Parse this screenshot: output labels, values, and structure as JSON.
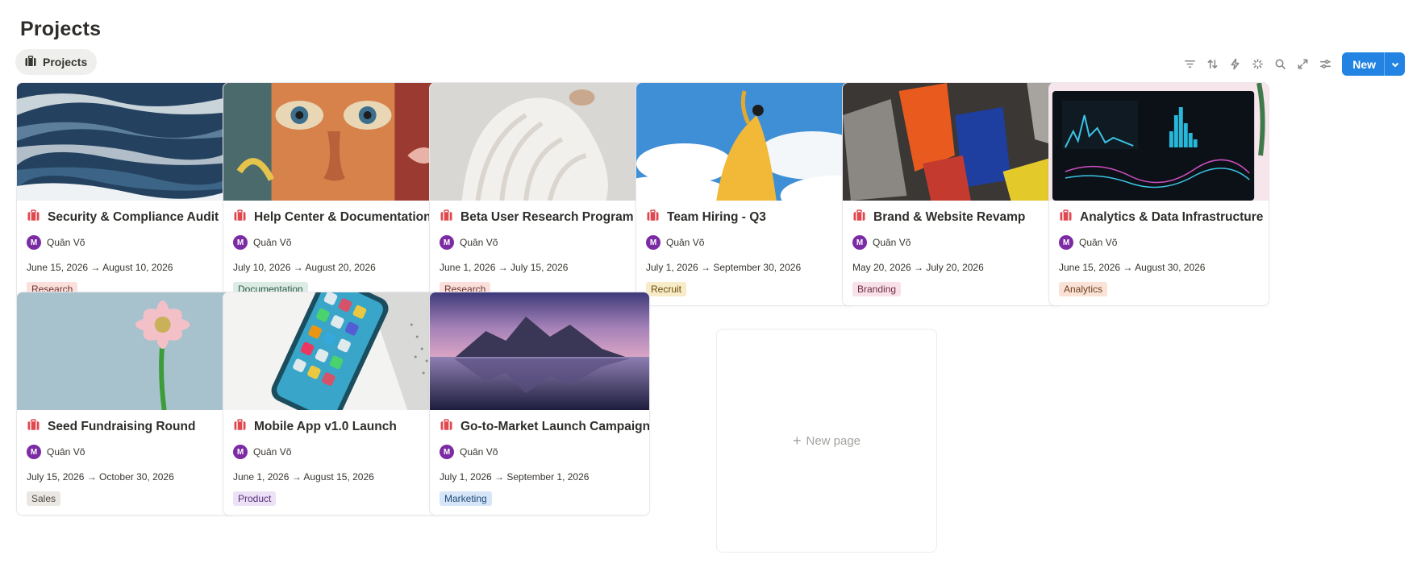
{
  "page": {
    "title": "Projects"
  },
  "view_tab": {
    "label": "Projects",
    "icon": "briefcase-icon"
  },
  "toolbar": {
    "icons": [
      "filter-icon",
      "sort-icon",
      "lightning-icon",
      "sparkle-icon",
      "search-icon",
      "expand-icon",
      "settings-sliders-icon"
    ],
    "new_label": "New",
    "accent": "#2383e2"
  },
  "cards": [
    {
      "title": "Security & Compliance Audit",
      "person": "Quân Võ",
      "avatar": "M",
      "dates": "June 15, 2026 → August 10, 2026",
      "tag": "Research",
      "tag_bg": "#fadfda",
      "tag_fg": "#6e3630",
      "cover": "ocean-waves"
    },
    {
      "title": "Help Center & Documentation",
      "person": "Quân Võ",
      "avatar": "M",
      "dates": "July 10, 2026 → August 20, 2026",
      "tag": "Documentation",
      "tag_bg": "#dcece4",
      "tag_fg": "#2b5a46",
      "cover": "graffiti-face"
    },
    {
      "title": "Beta User Research Program",
      "person": "Quân Võ",
      "avatar": "M",
      "dates": "June 1, 2026 → July 15, 2026",
      "tag": "Research",
      "tag_bg": "#fadfda",
      "tag_fg": "#6e3630",
      "cover": "white-sweater"
    },
    {
      "title": "Team Hiring - Q3",
      "person": "Quân Võ",
      "avatar": "M",
      "dates": "July 1, 2026 → September 30, 2026",
      "tag": "Recruit",
      "tag_bg": "#f7ecc7",
      "tag_fg": "#6b4d12",
      "cover": "sky-yellow-dress"
    },
    {
      "title": "Brand & Website Revamp",
      "person": "Quân Võ",
      "avatar": "M",
      "dates": "May 20, 2026 → July 20, 2026",
      "tag": "Branding",
      "tag_bg": "#f9e1ea",
      "tag_fg": "#6b2e44",
      "cover": "abstract-colors"
    },
    {
      "title": "Analytics & Data Infrastructure",
      "person": "Quân Võ",
      "avatar": "M",
      "dates": "June 15, 2026 → August 30, 2026",
      "tag": "Analytics",
      "tag_bg": "#fae3d6",
      "tag_fg": "#6e3d21",
      "cover": "analytics-screen"
    },
    {
      "title": "Seed Fundraising Round",
      "person": "Quân Võ",
      "avatar": "M",
      "dates": "July 15, 2026 → October 30, 2026",
      "tag": "Sales",
      "tag_bg": "#ebe8e4",
      "tag_fg": "#4a453f",
      "cover": "pink-gerbera"
    },
    {
      "title": "Mobile App v1.0 Launch",
      "person": "Quân Võ",
      "avatar": "M",
      "dates": "June 1, 2026 → August 15, 2026",
      "tag": "Product",
      "tag_bg": "#ede1f6",
      "tag_fg": "#55307a",
      "cover": "phone-laptop"
    },
    {
      "title": "Go-to-Market Launch Campaign",
      "person": "Quân Võ",
      "avatar": "M",
      "dates": "July 1, 2026 → September 1, 2026",
      "tag": "Marketing",
      "tag_bg": "#d6e6f8",
      "tag_fg": "#1f4a78",
      "cover": "mountain-sunset"
    }
  ],
  "new_page": {
    "label": "New page"
  }
}
